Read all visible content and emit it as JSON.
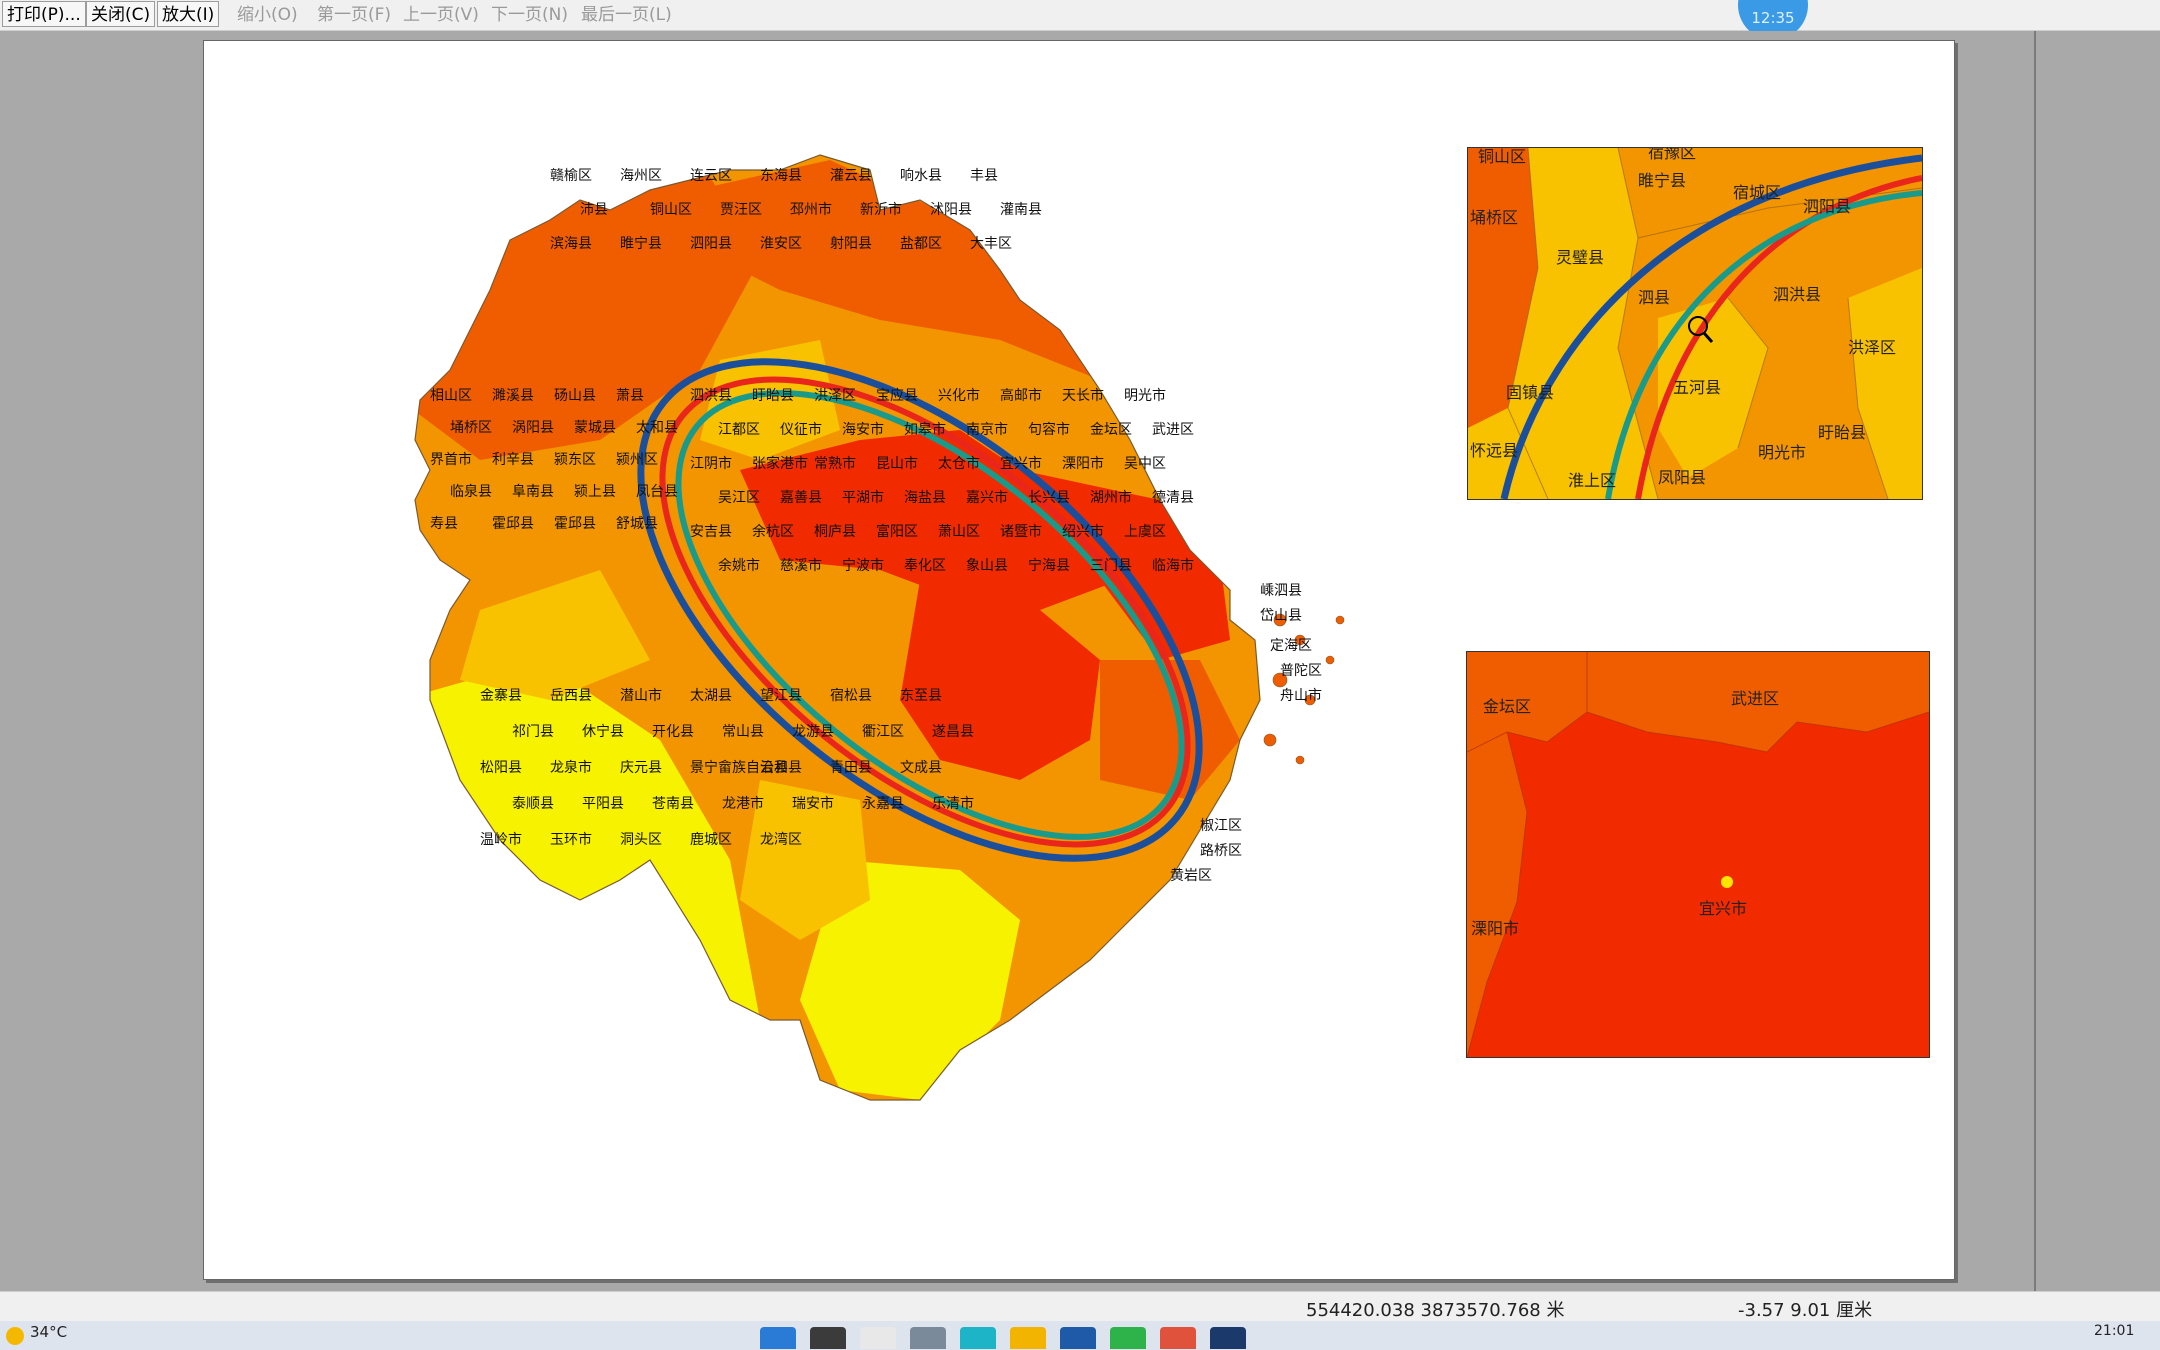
{
  "toolbar": {
    "print": "打印(P)...",
    "close": "关闭(C)",
    "zoom_in": "放大(I)",
    "zoom_out": "缩小(O)",
    "first_page": "第一页(F)",
    "prev_page": "上一页(V)",
    "next_page": "下一页(N)",
    "last_page": "最后一页(L)"
  },
  "clock_badge": "12:35",
  "colors": {
    "low": "#f7f200",
    "mid_low": "#f8c200",
    "mid": "#f39500",
    "mid_high": "#f05d00",
    "high": "#f12a00",
    "ellipse_blue": "#1b4f9c",
    "ellipse_red": "#e8261b",
    "ellipse_teal": "#1a9a8a",
    "point": "#ffe600"
  },
  "main_map": {
    "labels_north": [
      "赣榆区",
      "海州区",
      "连云区",
      "东海县",
      "灌云县",
      "响水县",
      "丰县",
      "沛县",
      "铜山区",
      "贾汪区",
      "邳州市",
      "新沂市",
      "沭阳县",
      "灌南县",
      "滨海县",
      "睢宁县",
      "泗阳县",
      "淮安区",
      "射阳县",
      "盐都区",
      "大丰区"
    ],
    "labels_west": [
      "相山区",
      "濉溪县",
      "砀山县",
      "萧县",
      "埇桥区",
      "涡阳县",
      "蒙城县",
      "太和县",
      "界首市",
      "利辛县",
      "颍东区",
      "颍州区",
      "临泉县",
      "阜南县",
      "颍上县",
      "凤台县",
      "寿县",
      "霍邱县",
      "霍邱县",
      "舒城县"
    ],
    "labels_center": [
      "泗洪县",
      "盱眙县",
      "洪泽区",
      "宝应县",
      "兴化市",
      "高邮市",
      "天长市",
      "明光市",
      "江都区",
      "仪征市",
      "海安市",
      "如皋市",
      "南京市",
      "句容市",
      "金坛区",
      "武进区",
      "江阴市",
      "张家港市",
      "常熟市",
      "昆山市",
      "太仓市",
      "宜兴市",
      "溧阳市",
      "吴中区",
      "吴江区",
      "嘉善县",
      "平湖市",
      "海盐县",
      "嘉兴市",
      "长兴县",
      "湖州市",
      "德清县",
      "安吉县",
      "余杭区",
      "桐庐县",
      "富阳区",
      "萧山区",
      "诸暨市",
      "绍兴市",
      "上虞区",
      "余姚市",
      "慈溪市",
      "宁波市",
      "奉化区",
      "象山县",
      "宁海县",
      "三门县",
      "临海市"
    ],
    "labels_south": [
      "金寨县",
      "岳西县",
      "潜山市",
      "太湖县",
      "望江县",
      "宿松县",
      "东至县",
      "祁门县",
      "休宁县",
      "开化县",
      "常山县",
      "龙游县",
      "衢江区",
      "遂昌县",
      "松阳县",
      "龙泉市",
      "庆元县",
      "景宁畲族自治县",
      "云和县",
      "青田县",
      "文成县",
      "泰顺县",
      "平阳县",
      "苍南县",
      "龙港市",
      "瑞安市",
      "永嘉县",
      "乐清市",
      "温岭市",
      "玉环市",
      "洞头区",
      "鹿城区",
      "龙湾区"
    ],
    "labels_east": [
      "嵊泗县",
      "岱山县",
      "定海区",
      "普陀区",
      "舟山市",
      "椒江区",
      "路桥区",
      "黄岩区"
    ]
  },
  "inset_top": {
    "labels": [
      "铜山区",
      "宿豫区",
      "睢宁县",
      "宿城区",
      "泗阳县",
      "埇桥区",
      "灵璧县",
      "泗县",
      "泗洪县",
      "洪泽区",
      "固镇县",
      "五河县",
      "盱眙县",
      "怀远县",
      "淮上区",
      "凤阳县",
      "明光市"
    ]
  },
  "inset_bottom": {
    "labels": [
      "金坛区",
      "武进区",
      "宜兴市",
      "溧阳市"
    ]
  },
  "status": {
    "coords": "554420.038  3873570.768 米",
    "measure": "-3.57  9.01 厘米"
  },
  "taskbar": {
    "weather": "34°C",
    "time": "21:01"
  }
}
